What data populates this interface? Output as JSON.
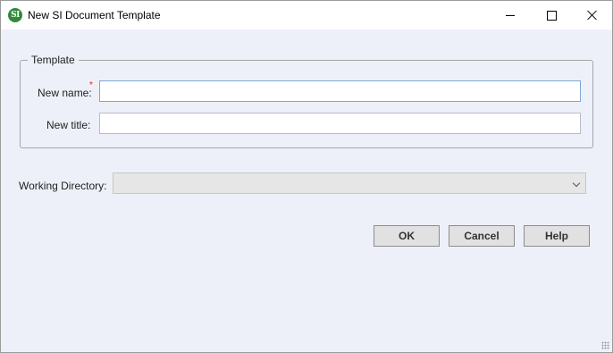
{
  "window": {
    "title": "New SI Document Template",
    "app_icon_text": "SI"
  },
  "template_group": {
    "legend": "Template",
    "new_name": {
      "label": "New name:",
      "required_marker": "*",
      "value": ""
    },
    "new_title": {
      "label": "New title:",
      "value": ""
    }
  },
  "working_directory": {
    "label": "Working Directory:",
    "value": ""
  },
  "buttons": {
    "ok": "OK",
    "cancel": "Cancel",
    "help": "Help"
  }
}
